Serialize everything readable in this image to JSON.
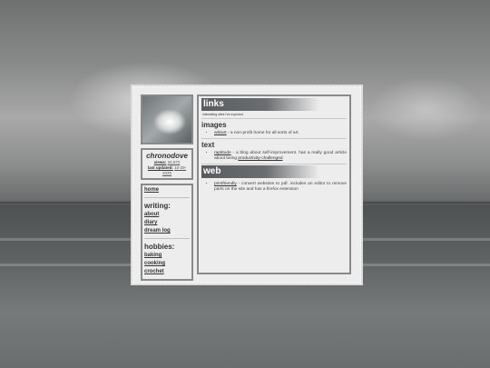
{
  "profile": {
    "name": "chronodove",
    "views_label": "views:",
    "views": "34,872",
    "updated_label": "last updated:",
    "updated": "10-29-2025"
  },
  "nav": {
    "home": "home",
    "writing_heading": "writing:",
    "writing": [
      "about",
      "diary",
      "dream log"
    ],
    "hobbies_heading": "hobbies:",
    "hobbies": [
      "baking",
      "cooking",
      "crochet"
    ]
  },
  "main": {
    "banner": "links",
    "subtitle": "interesting sites i've explored",
    "images_heading": "images",
    "images_items": [
      {
        "link": "wikiart",
        "text": " - a non-profit home for all sorts of art."
      }
    ],
    "text_heading": "text",
    "text_items": [
      {
        "link": "raptitude",
        "text": " - a blog about self-improvement. has a really good article about being ",
        "link2": "productivity-challenged"
      }
    ],
    "web_banner": "web",
    "web_items": [
      {
        "link": "printfriendly",
        "text": " - convert websites to pdf. includes an editor to remove parts on the site and has a firefox extension"
      }
    ]
  }
}
